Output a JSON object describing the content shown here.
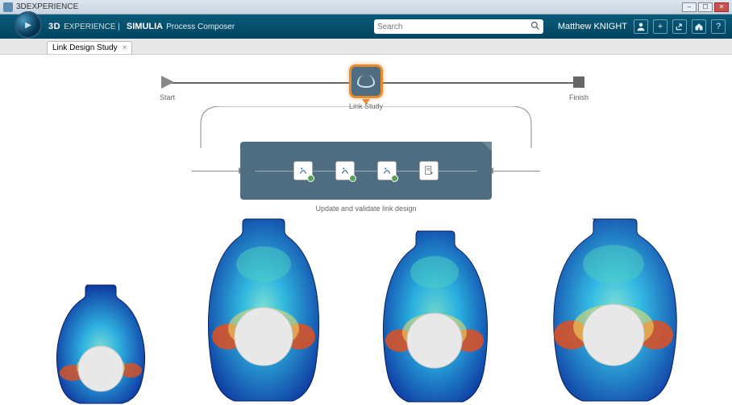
{
  "window": {
    "title": "3DEXPERIENCE"
  },
  "header": {
    "brand_bold": "3D",
    "brand_light": "EXPERIENCE |",
    "brand_app_bold": "SIMULIA",
    "brand_app_light": "Process Composer",
    "search_placeholder": "Search",
    "user": "Matthew KNIGHT"
  },
  "tabs": {
    "active": "Link Design Study"
  },
  "workflow": {
    "start_label": "Start",
    "finish_label": "Finish",
    "center_label": "Link Study"
  },
  "subprocess": {
    "caption": "Update and validate link design",
    "steps": [
      {
        "type": "ds",
        "name": "step-catia-1"
      },
      {
        "type": "ds",
        "name": "step-catia-2"
      },
      {
        "type": "ds",
        "name": "step-simulia"
      },
      {
        "type": "doc",
        "name": "step-report"
      }
    ]
  }
}
